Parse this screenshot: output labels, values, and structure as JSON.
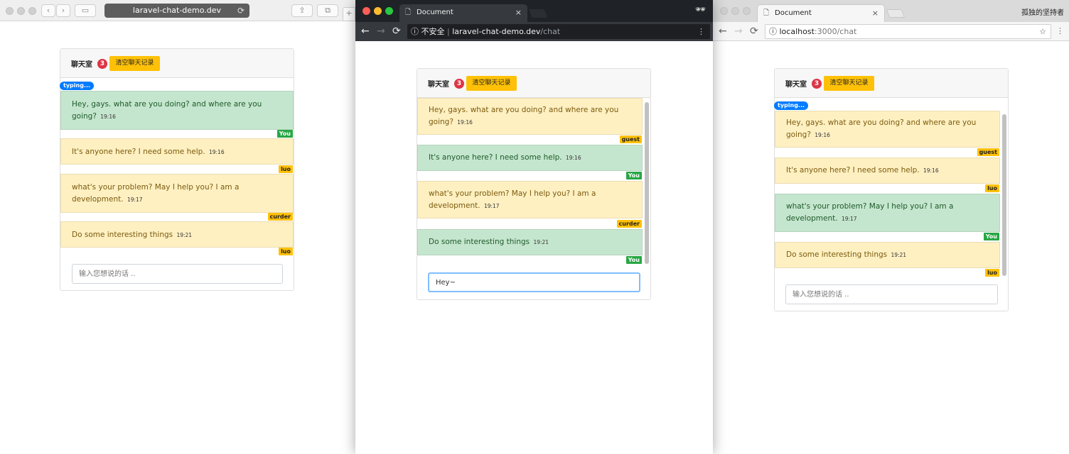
{
  "safari": {
    "url": "laravel-chat-demo.dev",
    "sidebar_glyph": "▭",
    "share_glyph": "⇪",
    "tabs_glyph": "⧉",
    "plus_glyph": "+"
  },
  "chrome_dark": {
    "tab_title": "Document",
    "close_glyph": "×",
    "insecure_label": "ⓘ 不安全",
    "url_host": "laravel-chat-demo.dev",
    "url_path": "/chat",
    "input_value": "Hey~"
  },
  "chrome_light": {
    "tab_title": "Document",
    "close_glyph": "×",
    "profile_name": "孤独的坚持者",
    "url_host": "localhost",
    "url_path": ":3000/chat"
  },
  "chat": {
    "title": "聊天室",
    "count": "3",
    "clear_button": "清空聊天记录",
    "typing": "typing...",
    "placeholder": "输入您想说的话 ..",
    "messages": [
      {
        "text": "Hey, gays. what are you doing? and where are you going?",
        "time": "19:16"
      },
      {
        "text": "It's anyone here? I need some help.",
        "time": "19:16"
      },
      {
        "text": "what's your problem? May I help you? I am a development.",
        "time": "19:17"
      },
      {
        "text": "Do some interesting things",
        "time": "19:21"
      }
    ],
    "names": {
      "you": "You",
      "guest": "guest",
      "luo": "luo",
      "curder": "curder"
    }
  },
  "icons": {
    "back": "←",
    "forward": "→",
    "reload": "⟳",
    "kebab": "⋮",
    "star": "☆",
    "document": "🗋",
    "incognito": "🕶"
  },
  "colors": {
    "self_message": "#c5e6ce",
    "other_message": "#fff0c2",
    "self_tag": "#28a745",
    "other_tag": "#ffc107",
    "badge_red": "#dc3545",
    "typing_blue": "#007bff"
  }
}
